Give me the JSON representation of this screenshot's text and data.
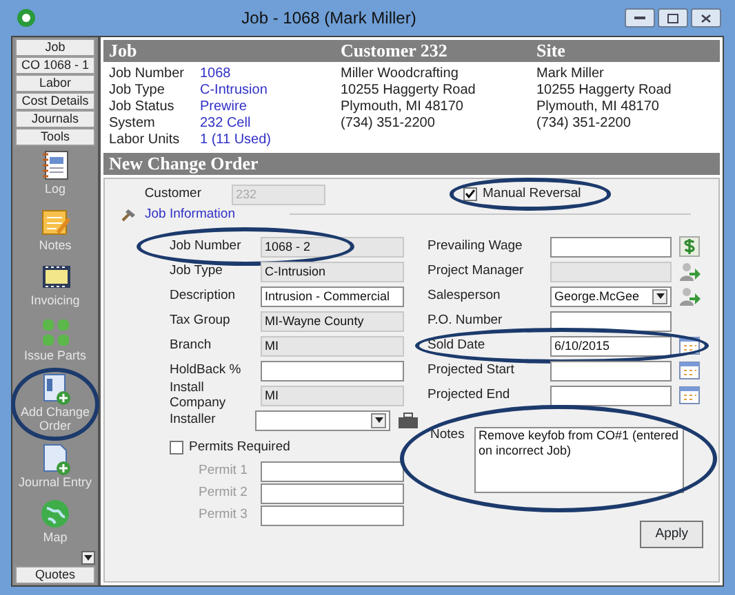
{
  "window": {
    "title": "Job - 1068 (Mark Miller)"
  },
  "sidebar": {
    "tabs": [
      {
        "label": "Job"
      },
      {
        "label": "CO 1068 - 1"
      },
      {
        "label": "Labor"
      },
      {
        "label": "Cost Details"
      },
      {
        "label": "Journals"
      },
      {
        "label": "Tools"
      }
    ],
    "tools": [
      {
        "label": "Log",
        "kind": "log",
        "highlighted": false
      },
      {
        "label": "Notes",
        "kind": "notes",
        "highlighted": false
      },
      {
        "label": "Invoicing",
        "kind": "invoice",
        "highlighted": false
      },
      {
        "label": "Issue Parts",
        "kind": "parts",
        "highlighted": false
      },
      {
        "label": "Add Change Order",
        "kind": "addorder",
        "highlighted": true
      },
      {
        "label": "Journal Entry",
        "kind": "journal",
        "highlighted": false
      },
      {
        "label": "Map",
        "kind": "map",
        "highlighted": false
      }
    ],
    "bottom_tab": "Quotes"
  },
  "header": {
    "job": {
      "title": "Job",
      "fields": [
        {
          "label": "Job Number",
          "value": "1068"
        },
        {
          "label": "Job Type",
          "value": "C-Intrusion"
        },
        {
          "label": "Job Status",
          "value": "Prewire"
        },
        {
          "label": "System",
          "value": "232 Cell"
        },
        {
          "label": "Labor Units",
          "value": "1 (11 Used)"
        }
      ]
    },
    "customer": {
      "title": "Customer 232",
      "lines": [
        "Miller Woodcrafting",
        "10255 Haggerty Road",
        "Plymouth, MI  48170",
        "(734) 351-2200"
      ]
    },
    "site": {
      "title": "Site",
      "lines": [
        "Mark Miller",
        "10255 Haggerty Road",
        "Plymouth, MI  48170",
        "(734) 351-2200"
      ]
    }
  },
  "change_order": {
    "title": "New Change Order",
    "customer": {
      "label": "Customer",
      "value": "232",
      "disabled": true
    },
    "manual_reversal": {
      "label": "Manual Reversal",
      "checked": true,
      "highlighted": true
    },
    "job_information_link": "Job Information",
    "left_fields": [
      {
        "label": "Job Number",
        "value": "1068 - 2",
        "kind": "text",
        "readonly": true,
        "highlighted": true
      },
      {
        "label": "Job Type",
        "value": "C-Intrusion",
        "kind": "text",
        "readonly": true,
        "highlighted": false
      },
      {
        "label": "Description",
        "value": "Intrusion - Commercial",
        "kind": "text",
        "readonly": false,
        "highlighted": false
      },
      {
        "label": "Tax Group",
        "value": "MI-Wayne County",
        "kind": "text",
        "readonly": true,
        "highlighted": false
      },
      {
        "label": "Branch",
        "value": "MI",
        "kind": "text",
        "readonly": true,
        "highlighted": false
      },
      {
        "label": "HoldBack  %",
        "kind": "text",
        "readonly": false,
        "highlighted": false
      },
      {
        "label": "Install Company",
        "value": "MI",
        "kind": "text",
        "readonly": true,
        "highlighted": false
      },
      {
        "label": "Installer",
        "kind": "dropdown",
        "readonly": false,
        "highlighted": false,
        "action": {
          "kind": "toolbox"
        }
      }
    ],
    "permits_required": {
      "label": "Permits Required",
      "checked": false
    },
    "permits": [
      {
        "label": "Permit 1"
      },
      {
        "label": "Permit 2"
      },
      {
        "label": "Permit 3"
      }
    ],
    "right_fields": [
      {
        "label": "Prevailing Wage",
        "kind": "text",
        "readonly": false,
        "highlighted": false,
        "action": {
          "kind": "money"
        }
      },
      {
        "label": "Project Manager",
        "kind": "text",
        "readonly": true,
        "highlighted": false,
        "action": {
          "kind": "person"
        }
      },
      {
        "label": "Salesperson",
        "value": "George.McGee",
        "kind": "dropdown",
        "readonly": false,
        "highlighted": false,
        "action": {
          "kind": "person"
        }
      },
      {
        "label": "P.O. Number",
        "kind": "text",
        "readonly": false,
        "highlighted": false
      },
      {
        "label": "Sold Date",
        "value": "6/10/2015",
        "kind": "text",
        "readonly": false,
        "highlighted": true,
        "action": {
          "kind": "calendar"
        }
      },
      {
        "label": "Projected Start",
        "kind": "text",
        "readonly": false,
        "highlighted": false,
        "action": {
          "kind": "calendar"
        }
      },
      {
        "label": "Projected End",
        "kind": "text",
        "readonly": false,
        "highlighted": false,
        "action": {
          "kind": "calendar"
        }
      }
    ],
    "notes": {
      "label": "Notes",
      "value": "Remove keyfob from CO#1 (entered on incorrect Job)",
      "highlighted": true
    },
    "apply": "Apply"
  }
}
